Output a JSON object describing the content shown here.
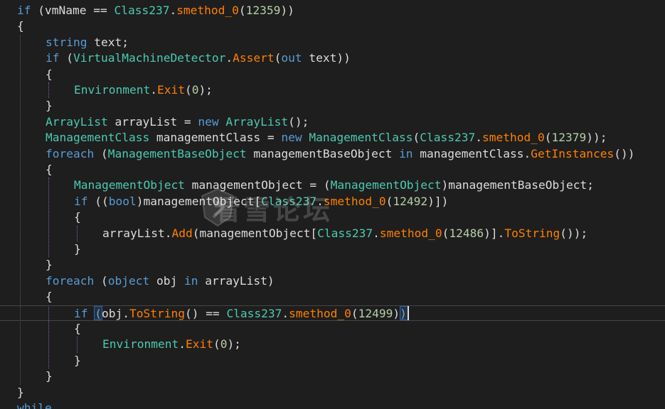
{
  "editor": {
    "watermark_text": "看雪论坛",
    "colors": {
      "background": "#1e1e1e",
      "keyword": "#569cd6",
      "type": "#4ec9b0",
      "method": "#ff8000",
      "number": "#b5cea8",
      "default": "#dcdcdc",
      "guide": "#5a5a5a",
      "active_guide": "#8a5fa8"
    },
    "lines": [
      {
        "indent": 0,
        "tokens": [
          [
            "kw",
            "if"
          ],
          [
            "t",
            " ("
          ],
          [
            "t",
            "vmName"
          ],
          [
            "t",
            " == "
          ],
          [
            "ty",
            "Class237"
          ],
          [
            "t",
            "."
          ],
          [
            "fn",
            "smethod_0"
          ],
          [
            "t",
            "("
          ],
          [
            "num",
            "12359"
          ],
          [
            "t",
            "))"
          ]
        ]
      },
      {
        "indent": 0,
        "tokens": [
          [
            "t",
            "{"
          ]
        ]
      },
      {
        "indent": 1,
        "tokens": [
          [
            "kw",
            "string"
          ],
          [
            "t",
            " text;"
          ]
        ]
      },
      {
        "indent": 1,
        "tokens": [
          [
            "kw",
            "if"
          ],
          [
            "t",
            " ("
          ],
          [
            "ty",
            "VirtualMachineDetector"
          ],
          [
            "t",
            "."
          ],
          [
            "fn",
            "Assert"
          ],
          [
            "t",
            "("
          ],
          [
            "kw",
            "out"
          ],
          [
            "t",
            " text))"
          ]
        ]
      },
      {
        "indent": 1,
        "tokens": [
          [
            "t",
            "{"
          ]
        ]
      },
      {
        "indent": 2,
        "tokens": [
          [
            "ty",
            "Environment"
          ],
          [
            "t",
            "."
          ],
          [
            "fn",
            "Exit"
          ],
          [
            "t",
            "("
          ],
          [
            "num",
            "0"
          ],
          [
            "t",
            ");"
          ]
        ]
      },
      {
        "indent": 1,
        "tokens": [
          [
            "t",
            "}"
          ]
        ]
      },
      {
        "indent": 1,
        "tokens": [
          [
            "ty",
            "ArrayList"
          ],
          [
            "t",
            " arrayList = "
          ],
          [
            "kw",
            "new"
          ],
          [
            "t",
            " "
          ],
          [
            "ty",
            "ArrayList"
          ],
          [
            "t",
            "();"
          ]
        ]
      },
      {
        "indent": 1,
        "tokens": [
          [
            "ty",
            "ManagementClass"
          ],
          [
            "t",
            " managementClass = "
          ],
          [
            "kw",
            "new"
          ],
          [
            "t",
            " "
          ],
          [
            "ty",
            "ManagementClass"
          ],
          [
            "t",
            "("
          ],
          [
            "ty",
            "Class237"
          ],
          [
            "t",
            "."
          ],
          [
            "fn",
            "smethod_0"
          ],
          [
            "t",
            "("
          ],
          [
            "num",
            "12379"
          ],
          [
            "t",
            "));"
          ]
        ]
      },
      {
        "indent": 1,
        "tokens": [
          [
            "kw",
            "foreach"
          ],
          [
            "t",
            " ("
          ],
          [
            "ty",
            "ManagementBaseObject"
          ],
          [
            "t",
            " managementBaseObject "
          ],
          [
            "kw",
            "in"
          ],
          [
            "t",
            " managementClass."
          ],
          [
            "fn",
            "GetInstances"
          ],
          [
            "t",
            "())"
          ]
        ]
      },
      {
        "indent": 1,
        "tokens": [
          [
            "t",
            "{"
          ]
        ]
      },
      {
        "indent": 2,
        "tokens": [
          [
            "ty",
            "ManagementObject"
          ],
          [
            "t",
            " managementObject = ("
          ],
          [
            "ty",
            "ManagementObject"
          ],
          [
            "t",
            ")managementBaseObject;"
          ]
        ]
      },
      {
        "indent": 2,
        "tokens": [
          [
            "kw",
            "if"
          ],
          [
            "t",
            " (("
          ],
          [
            "kw",
            "bool"
          ],
          [
            "t",
            ")managementObject["
          ],
          [
            "ty",
            "Class237"
          ],
          [
            "t",
            "."
          ],
          [
            "fn",
            "smethod_0"
          ],
          [
            "t",
            "("
          ],
          [
            "num",
            "12492"
          ],
          [
            "t",
            ")])"
          ]
        ]
      },
      {
        "indent": 2,
        "tokens": [
          [
            "t",
            "{"
          ]
        ]
      },
      {
        "indent": 3,
        "tokens": [
          [
            "t",
            "arrayList."
          ],
          [
            "fn",
            "Add"
          ],
          [
            "t",
            "(managementObject["
          ],
          [
            "ty",
            "Class237"
          ],
          [
            "t",
            "."
          ],
          [
            "fn",
            "smethod_0"
          ],
          [
            "t",
            "("
          ],
          [
            "num",
            "12486"
          ],
          [
            "t",
            ")]."
          ],
          [
            "fn",
            "ToString"
          ],
          [
            "t",
            "());"
          ]
        ]
      },
      {
        "indent": 2,
        "tokens": [
          [
            "t",
            "}"
          ]
        ]
      },
      {
        "indent": 1,
        "tokens": [
          [
            "t",
            "}"
          ]
        ]
      },
      {
        "indent": 1,
        "tokens": [
          [
            "kw",
            "foreach"
          ],
          [
            "t",
            " ("
          ],
          [
            "kw",
            "object"
          ],
          [
            "t",
            " obj "
          ],
          [
            "kw",
            "in"
          ],
          [
            "t",
            " arrayList)"
          ]
        ]
      },
      {
        "indent": 1,
        "tokens": [
          [
            "t",
            "{"
          ]
        ]
      },
      {
        "indent": 2,
        "current": true,
        "tokens": [
          [
            "kw",
            "if"
          ],
          [
            "t",
            " (obj."
          ],
          [
            "fn",
            "ToString"
          ],
          [
            "t",
            "() == "
          ],
          [
            "ty",
            "Class237"
          ],
          [
            "t",
            "."
          ],
          [
            "fn",
            "smethod_0"
          ],
          [
            "t",
            "("
          ],
          [
            "num",
            "12499"
          ],
          [
            "t",
            "))"
          ]
        ]
      },
      {
        "indent": 2,
        "tokens": [
          [
            "t",
            "{"
          ]
        ]
      },
      {
        "indent": 3,
        "tokens": [
          [
            "ty",
            "Environment"
          ],
          [
            "t",
            "."
          ],
          [
            "fn",
            "Exit"
          ],
          [
            "t",
            "("
          ],
          [
            "num",
            "0"
          ],
          [
            "t",
            ");"
          ]
        ]
      },
      {
        "indent": 2,
        "tokens": [
          [
            "t",
            "}"
          ]
        ]
      },
      {
        "indent": 1,
        "tokens": [
          [
            "t",
            "}"
          ]
        ]
      },
      {
        "indent": 0,
        "tokens": [
          [
            "t",
            "}"
          ]
        ]
      },
      {
        "indent": 0,
        "tokens": [
          [
            "kw",
            "while"
          ]
        ]
      }
    ]
  }
}
